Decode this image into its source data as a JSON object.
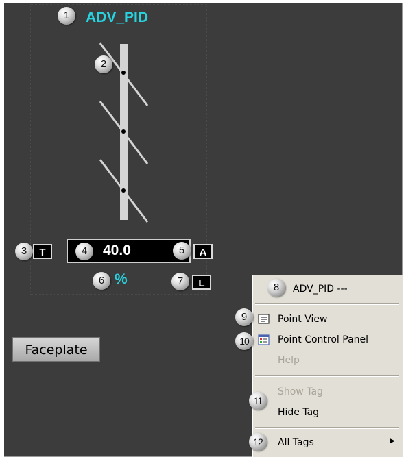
{
  "graphic": {
    "tag_name": "ADV_PID",
    "value": "40.0",
    "unit": "%",
    "buttons": {
      "tune": "T",
      "auto": "A",
      "limit": "L"
    },
    "faceplate_label": "Faceplate",
    "accent_color": "#28d2df"
  },
  "context_menu": {
    "header": "ADV_PID ---",
    "items": [
      {
        "label": "Point View",
        "icon": "point-view-icon",
        "enabled": true
      },
      {
        "label": "Point Control Panel",
        "icon": "control-panel-icon",
        "enabled": true
      },
      {
        "label": "Help",
        "enabled": false
      },
      {
        "label": "Show Tag",
        "enabled": false
      },
      {
        "label": "Hide Tag",
        "enabled": true
      },
      {
        "label": "All Tags",
        "enabled": true,
        "submenu": true
      }
    ],
    "submenu_arrow": "▶"
  },
  "callouts": [
    "1",
    "2",
    "3",
    "4",
    "5",
    "6",
    "7",
    "8",
    "9",
    "10",
    "11",
    "12"
  ]
}
